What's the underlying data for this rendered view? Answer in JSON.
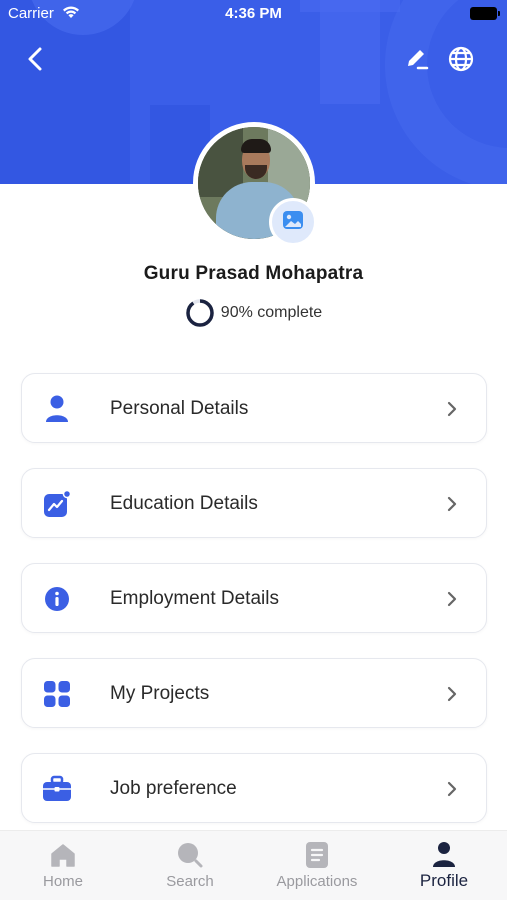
{
  "status_bar": {
    "carrier": "Carrier",
    "time": "4:36 PM"
  },
  "header": {
    "back_icon": "chevron-left-icon",
    "edit_icon": "pencil-icon",
    "language_icon": "globe-icon",
    "brand_color": "#3a5ee8"
  },
  "profile": {
    "name": "Guru Prasad Mohapatra",
    "completion_percent": 90,
    "completion_text": "90% complete",
    "photo_badge_icon": "image-icon"
  },
  "menu": {
    "items": [
      {
        "label": "Personal Details",
        "icon": "person-icon"
      },
      {
        "label": "Education Details",
        "icon": "trend-chart-icon"
      },
      {
        "label": "Employment Details",
        "icon": "info-icon"
      },
      {
        "label": "My Projects",
        "icon": "grid-icon"
      },
      {
        "label": "Job preference",
        "icon": "briefcase-icon"
      }
    ],
    "accent_color": "#3b5fe4"
  },
  "tabbar": {
    "tabs": [
      {
        "label": "Home",
        "icon": "home-icon",
        "active": false
      },
      {
        "label": "Search",
        "icon": "search-icon",
        "active": false
      },
      {
        "label": "Applications",
        "icon": "document-icon",
        "active": false
      },
      {
        "label": "Profile",
        "icon": "person-icon",
        "active": true
      }
    ],
    "active_color": "#1b2340",
    "inactive_color": "#b5b5ba"
  }
}
